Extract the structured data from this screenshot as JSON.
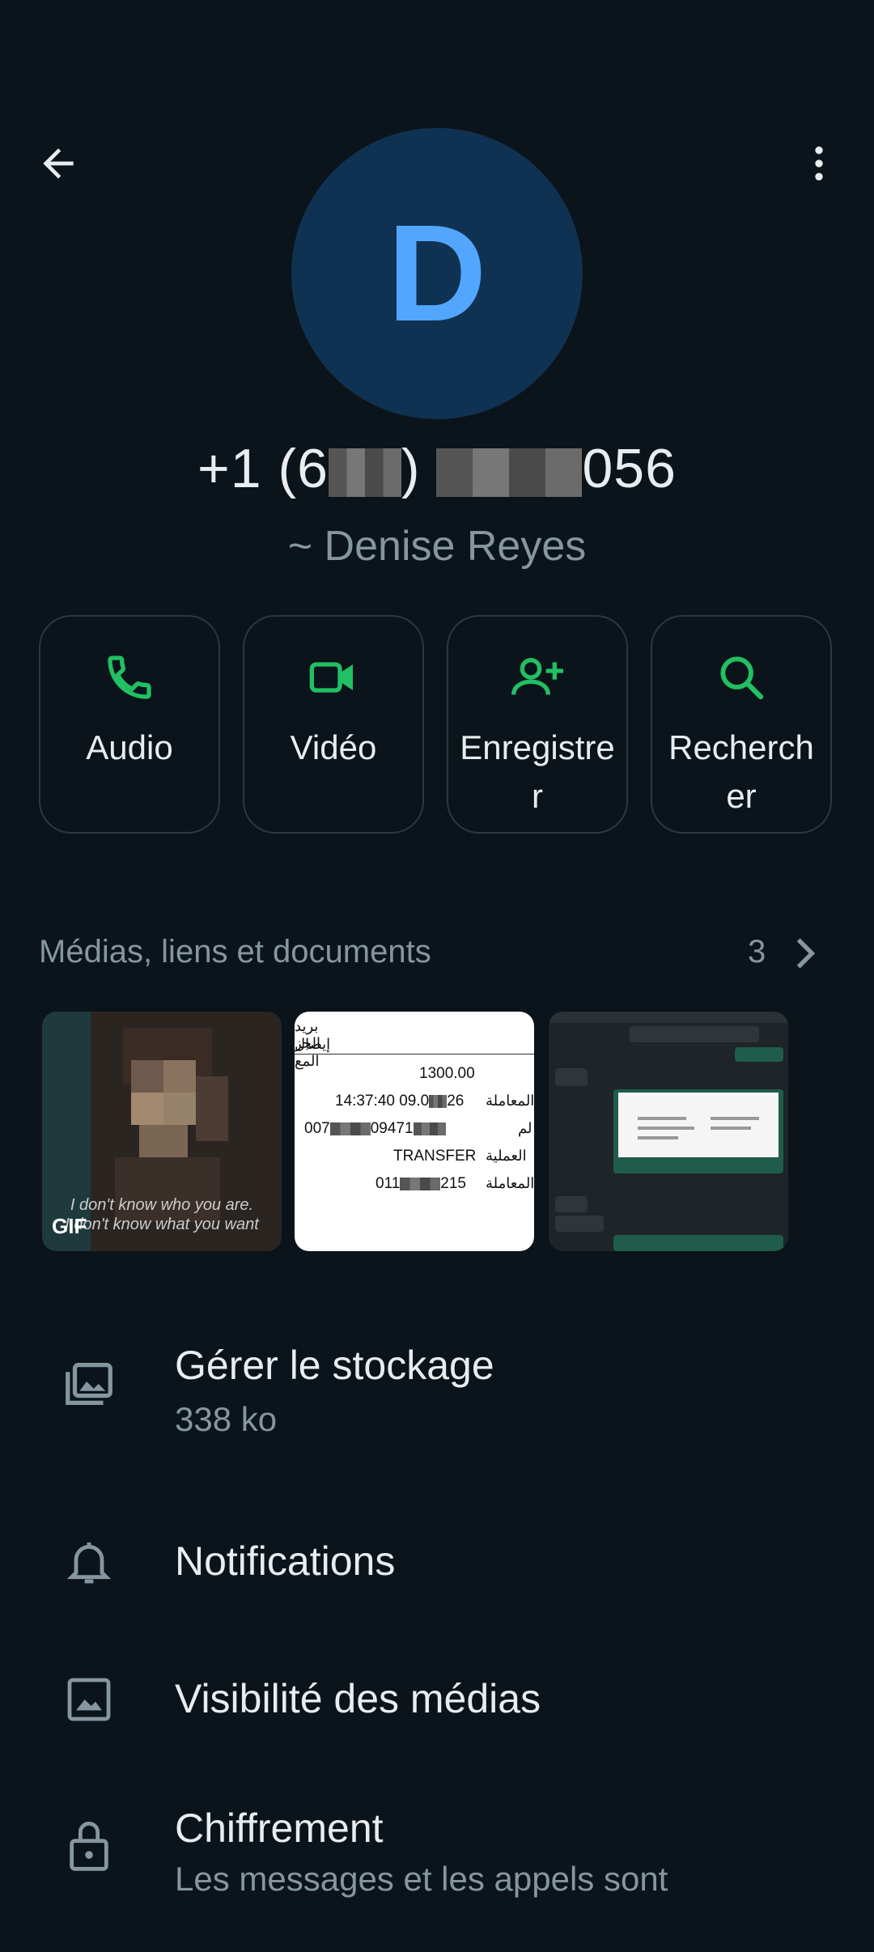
{
  "header": {
    "back_icon": "arrow-left-icon",
    "more_icon": "more-vert-icon"
  },
  "contact": {
    "avatar_letter": "D",
    "phone_prefix": "+1 (6",
    "phone_mid": ")",
    "phone_suffix": "056",
    "name": "~ Denise Reyes"
  },
  "actions": [
    {
      "label": "Audio",
      "icon": "phone-icon"
    },
    {
      "label": "Vidéo",
      "icon": "video-icon"
    },
    {
      "label": "Enregistrer",
      "icon": "add-person-icon"
    },
    {
      "label": "Rechercher",
      "icon": "search-icon"
    }
  ],
  "media": {
    "title": "Médias, liens et documents",
    "count": "3",
    "thumb1": {
      "badge": "GIF",
      "caption1": "I don't know who you are.",
      "caption2": "I don't know what you want"
    },
    "thumb2": {
      "header1": "بريد الجز",
      "header2": "إيصال المع",
      "amount": "1300.00",
      "date_prefix": "14:37:40 09.0",
      "date_suffix": "26",
      "date_label": "خ المعاملة",
      "acct_prefix": "007",
      "acct_mid": "09471",
      "acct_label": "لم",
      "type": "TRANSFER",
      "type_label": "العملية",
      "ref_prefix": "011",
      "ref_suffix": "215",
      "ref_label": "ف المعاملة"
    }
  },
  "settings": [
    {
      "title": "Gérer le stockage",
      "subtitle": "338 ko",
      "icon": "storage-icon"
    },
    {
      "title": "Notifications",
      "icon": "bell-icon"
    },
    {
      "title": "Visibilité des médias",
      "icon": "image-icon"
    },
    {
      "title": "Chiffrement",
      "subtitle": "Les messages et les appels sont",
      "icon": "lock-icon"
    }
  ],
  "colors": {
    "accent": "#21c063",
    "avatar_bg": "#103252",
    "avatar_fg": "#53a6fd",
    "background": "#0b141a"
  }
}
